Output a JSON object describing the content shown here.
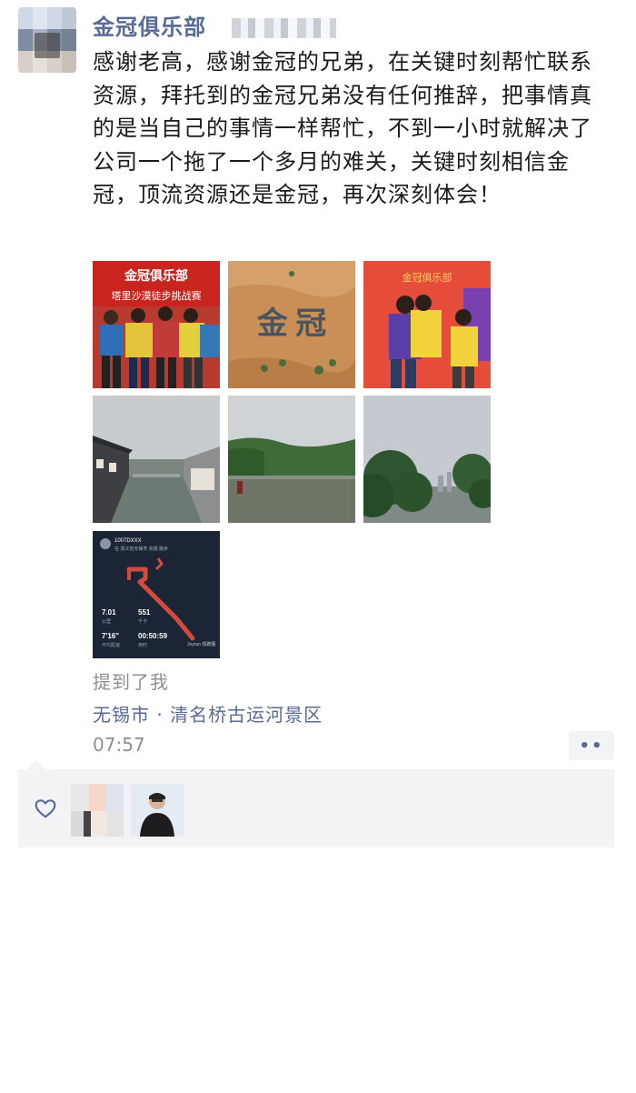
{
  "post": {
    "author": "金冠俱乐部",
    "content": "感谢老高，感谢金冠的兄弟，在关键时刻帮忙联系资源，拜托到的金冠兄弟没有任何推辞，把事情真的是当自己的事情一样帮忙，不到一小时就解决了公司一个拖了一个多月的难关，关键时刻相信金冠，顶流资源还是金冠，再次深刻体会！",
    "mention": "提到了我",
    "location": "无锡市 · 清名桥古运河景区",
    "time": "07:57",
    "more_label": "••"
  },
  "photos": {
    "p1_banner": "金冠俱乐部",
    "p1_subtitle": "塔里沙漠徒步挑战赛",
    "p2_sand_text": "金 冠",
    "p3_logo": "金冠俱乐部",
    "p7_user": "1007DXXX",
    "p7_route_desc": "在 浙江省无锡市 完成 跑步",
    "p7_stat1_value": "7.01",
    "p7_stat1_label": "公里",
    "p7_stat2_value": "551",
    "p7_stat2_label": "千卡",
    "p7_stat3_value": "7'16\"",
    "p7_stat3_label": "平均配速",
    "p7_stat4_value": "00:50:59",
    "p7_stat4_label": "用时",
    "p7_brand": "Joyrun 悦跑圈"
  },
  "icons": {
    "like": "heart-outline-icon"
  },
  "colors": {
    "link_blue": "#576b95",
    "meta_gray": "#8f8f8f",
    "like_bg": "#f3f3f5"
  }
}
